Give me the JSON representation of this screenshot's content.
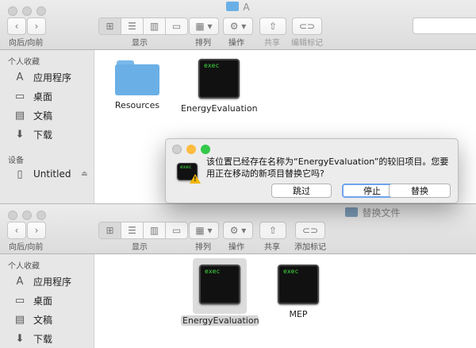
{
  "window1": {
    "title": "A",
    "toolbar": {
      "back_forward": "向后/向前",
      "view": "显示",
      "arrange": "排列",
      "action": "操作",
      "share": "共享",
      "edit_tags": "编辑标记"
    },
    "sidebar": {
      "favorites_header": "个人收藏",
      "items": [
        "应用程序",
        "桌面",
        "文稿",
        "下载"
      ],
      "devices_header": "设备",
      "device": "Untitled"
    },
    "files": [
      {
        "name": "Resources",
        "icon": "folder-icon"
      },
      {
        "name": "EnergyEvaluation",
        "icon": "exec-icon",
        "badge": "exec"
      }
    ]
  },
  "dialog": {
    "message": "该位置已经存在名称为“EnergyEvaluation”的较旧项目。您要用正在移动的新项目替换它吗?",
    "buttons": {
      "skip": "跳过",
      "stop": "停止",
      "replace": "替换"
    },
    "icon_badge": "exec"
  },
  "window2": {
    "title": "替换文件",
    "toolbar": {
      "back_forward": "向后/向前",
      "view": "显示",
      "arrange": "排列",
      "action": "操作",
      "share": "共享",
      "add_tags": "添加标记"
    },
    "sidebar": {
      "favorites_header": "个人收藏",
      "items": [
        "应用程序",
        "桌面",
        "文稿",
        "下载"
      ]
    },
    "files": [
      {
        "name": "EnergyEvaluation",
        "icon": "exec-icon",
        "badge": "exec",
        "selected": true
      },
      {
        "name": "MEP",
        "icon": "exec-icon",
        "badge": "exec"
      }
    ]
  },
  "colors": {
    "folder": "#6ab0e6",
    "exec_text": "#3fdc3f",
    "primary_button": "#6ea4ee",
    "traffic_red": "#fc605c",
    "traffic_yellow": "#fdbc40",
    "traffic_green": "#34c84a"
  }
}
